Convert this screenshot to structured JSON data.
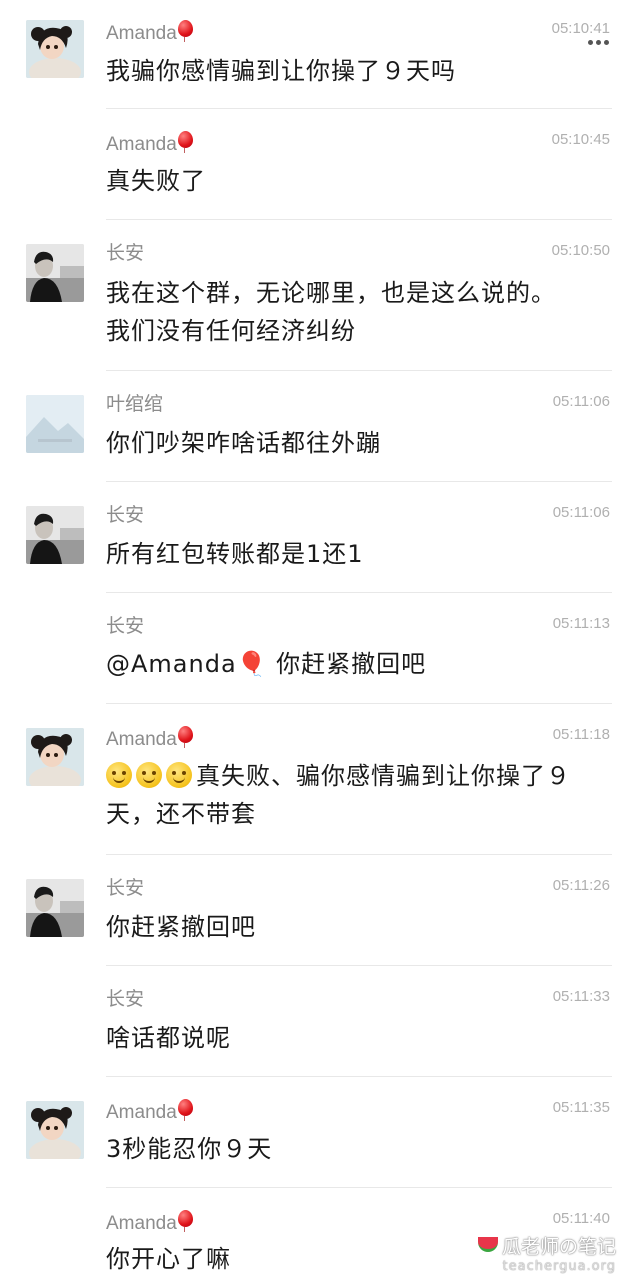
{
  "messages": [
    {
      "sender": "Amanda",
      "balloon": true,
      "time": "05:10:41",
      "lines": [
        "我骗你感情骗到让你操了９天吗"
      ],
      "avatar": "girl"
    },
    {
      "sender": "Amanda",
      "balloon": true,
      "time": "05:10:45",
      "lines": [
        "真失败了"
      ],
      "avatar": null
    },
    {
      "sender": "长安",
      "balloon": false,
      "time": "05:10:50",
      "lines": [
        "我在这个群，无论哪里，也是这么说的。",
        "我们没有任何经济纠纷"
      ],
      "avatar": "man"
    },
    {
      "sender": "叶绾绾",
      "balloon": false,
      "time": "05:11:06",
      "lines": [
        "你们吵架咋啥话都往外蹦"
      ],
      "avatar": "landscape"
    },
    {
      "sender": "长安",
      "balloon": false,
      "time": "05:11:06",
      "lines": [
        "所有红包转账都是1还1"
      ],
      "avatar": "man"
    },
    {
      "sender": "长安",
      "balloon": false,
      "time": "05:11:13",
      "lines": [
        "@Amanda🎈 你赶紧撤回吧"
      ],
      "avatar": null
    },
    {
      "sender": "Amanda",
      "balloon": true,
      "time": "05:11:18",
      "lines": [
        "真失败、骗你感情骗到让你操了９",
        "天，还不带套"
      ],
      "avatar": "girl",
      "emoji_prefix": 3
    },
    {
      "sender": "长安",
      "balloon": false,
      "time": "05:11:26",
      "lines": [
        "你赶紧撤回吧"
      ],
      "avatar": "man"
    },
    {
      "sender": "长安",
      "balloon": false,
      "time": "05:11:33",
      "lines": [
        "啥话都说呢"
      ],
      "avatar": null
    },
    {
      "sender": "Amanda",
      "balloon": true,
      "time": "05:11:35",
      "lines": [
        "3秒能忍你９天"
      ],
      "avatar": "girl"
    },
    {
      "sender": "Amanda",
      "balloon": true,
      "time": "05:11:40",
      "lines": [
        "你开心了嘛"
      ],
      "avatar": null
    }
  ],
  "watermark": {
    "main": "瓜老师の笔记",
    "sub": "teachergua.org"
  },
  "icons": {
    "more": "more-icon",
    "balloon": "balloon-icon",
    "emoji": "smile-emoji-icon",
    "watermark": "watermelon-icon"
  }
}
